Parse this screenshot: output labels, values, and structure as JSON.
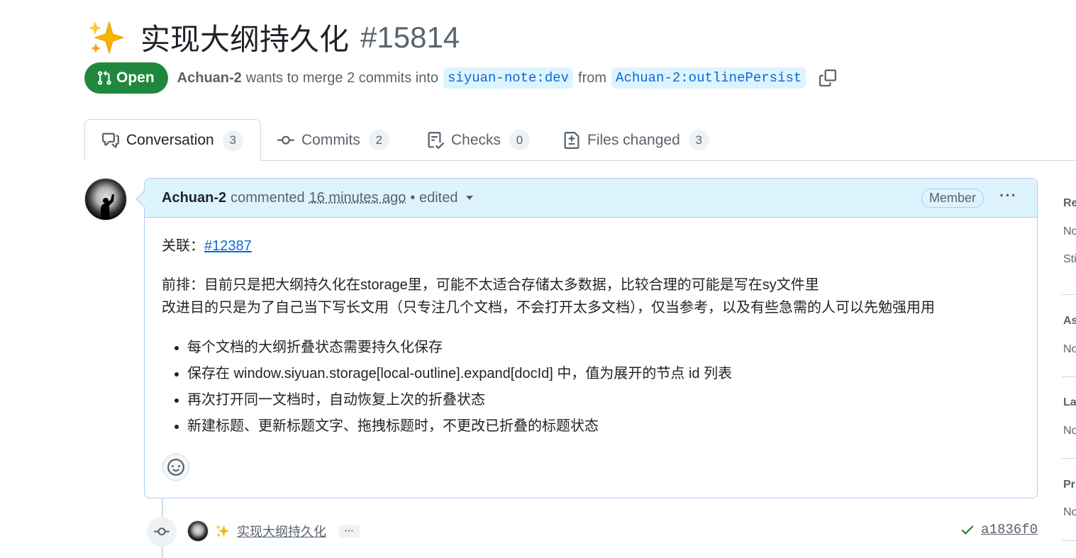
{
  "pr": {
    "title": "实现大纲持久化",
    "number": "#15814",
    "state": "Open",
    "author": "Achuan-2",
    "merge_text": "wants to merge 2 commits into",
    "base_branch": "siyuan-note:dev",
    "from_text": "from",
    "head_branch": "Achuan-2:outlinePersist"
  },
  "tabs": [
    {
      "label": "Conversation",
      "count": "3"
    },
    {
      "label": "Commits",
      "count": "2"
    },
    {
      "label": "Checks",
      "count": "0"
    },
    {
      "label": "Files changed",
      "count": "3"
    }
  ],
  "comment": {
    "author": "Achuan-2",
    "action": "commented",
    "time": "16 minutes ago",
    "edited": "• edited",
    "role": "Member",
    "related_label": "关联：",
    "related_link": "#12387",
    "para1": "前排：目前只是把大纲持久化在storage里，可能不太适合存储太多数据，比较合理的可能是写在sy文件里",
    "para2": "改进目的只是为了自己当下写长文用（只专注几个文档，不会打开太多文档），仅当参考，以及有些急需的人可以先勉强用用",
    "bullets": [
      "每个文档的大纲折叠状态需要持久化保存",
      "保存在 window.siyuan.storage[local-outline].expand[docId] 中，值为展开的节点 id 列表",
      "再次打开同一文档时，自动恢复上次的折叠状态",
      "新建标题、更新标题文字、拖拽标题时，不更改已折叠的标题状态"
    ]
  },
  "commit": {
    "message": "实现大纲持久化",
    "more": "···",
    "sha": "a1836f0",
    "status": "success"
  },
  "sidebar": {
    "items": [
      "Re",
      "No",
      "Sti",
      "As",
      "No",
      "La",
      "No",
      "Pr",
      "No"
    ]
  },
  "colors": {
    "open_green": "#1f883d",
    "accent_blue": "#0969da",
    "comment_header_bg": "#ddf4ff",
    "muted": "#59636e"
  }
}
